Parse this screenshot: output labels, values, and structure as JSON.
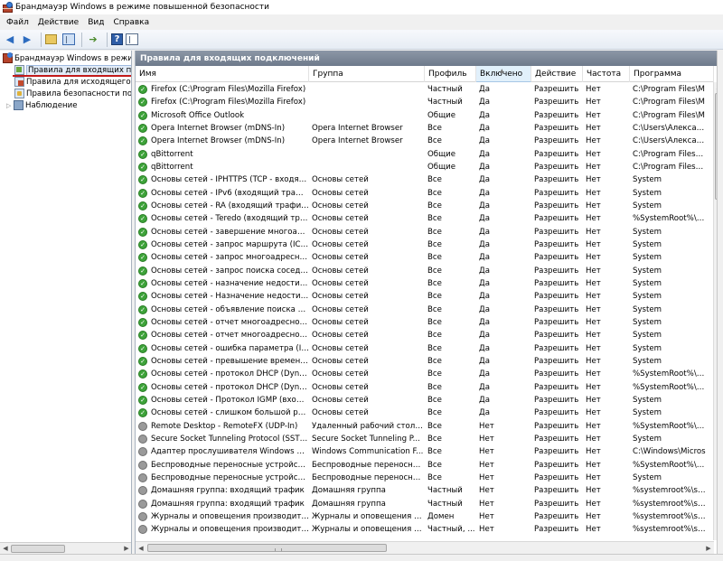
{
  "window": {
    "title": "Брандмауэр Windows в режиме повышенной безопасности"
  },
  "menu": [
    "Файл",
    "Действие",
    "Вид",
    "Справка"
  ],
  "toolbar": {
    "icons": [
      "back-arrow-icon",
      "forward-arrow-icon",
      "folder-up-icon",
      "show-hide-tree-icon",
      "export-list-icon",
      "help-icon",
      "show-hide-action-pane-icon"
    ]
  },
  "tree": {
    "root": "Брандмауэр Windows в режим",
    "items": [
      {
        "label": "Правила для входящих по,",
        "icon": "inbound-rules-icon",
        "selected": true
      },
      {
        "label": "Правила для исходящего г",
        "icon": "outbound-rules-icon"
      },
      {
        "label": "Правила безопасности по,",
        "icon": "connection-security-icon"
      },
      {
        "label": "Наблюдение",
        "icon": "monitoring-icon",
        "expandable": true
      }
    ]
  },
  "panel": {
    "title": "Правила для входящих подключений"
  },
  "columns": [
    "Имя",
    "Группа",
    "Профиль",
    "Включено",
    "Действие",
    "Частота",
    "Программа"
  ],
  "sorted_column": "Включено",
  "rules": [
    {
      "enabled": true,
      "name": "Firefox (C:\\Program Files\\Mozilla Firefox)",
      "group": "",
      "profile": "Частный",
      "on": "Да",
      "action": "Разрешить",
      "override": "Нет",
      "program": "C:\\Program Files\\M"
    },
    {
      "enabled": true,
      "name": "Firefox (C:\\Program Files\\Mozilla Firefox)",
      "group": "",
      "profile": "Частный",
      "on": "Да",
      "action": "Разрешить",
      "override": "Нет",
      "program": "C:\\Program Files\\M"
    },
    {
      "enabled": true,
      "name": "Microsoft Office Outlook",
      "group": "",
      "profile": "Общие",
      "on": "Да",
      "action": "Разрешить",
      "override": "Нет",
      "program": "C:\\Program Files\\M"
    },
    {
      "enabled": true,
      "name": "Opera Internet Browser (mDNS-In)",
      "group": "Opera Internet Browser",
      "profile": "Все",
      "on": "Да",
      "action": "Разрешить",
      "override": "Нет",
      "program": "C:\\Users\\Александ"
    },
    {
      "enabled": true,
      "name": "Opera Internet Browser (mDNS-In)",
      "group": "Opera Internet Browser",
      "profile": "Все",
      "on": "Да",
      "action": "Разрешить",
      "override": "Нет",
      "program": "C:\\Users\\Александ"
    },
    {
      "enabled": true,
      "name": "qBittorrent",
      "group": "",
      "profile": "Общие",
      "on": "Да",
      "action": "Разрешить",
      "override": "Нет",
      "program": "C:\\Program Files\\qB"
    },
    {
      "enabled": true,
      "name": "qBittorrent",
      "group": "",
      "profile": "Общие",
      "on": "Да",
      "action": "Разрешить",
      "override": "Нет",
      "program": "C:\\Program Files\\qB"
    },
    {
      "enabled": true,
      "name": "Основы сетей - IPHTTPS (TCP - входящ...",
      "group": "Основы сетей",
      "profile": "Все",
      "on": "Да",
      "action": "Разрешить",
      "override": "Нет",
      "program": "System"
    },
    {
      "enabled": true,
      "name": "Основы сетей - IPv6 (входящий трафик ...",
      "group": "Основы сетей",
      "profile": "Все",
      "on": "Да",
      "action": "Разрешить",
      "override": "Нет",
      "program": "System"
    },
    {
      "enabled": true,
      "name": "Основы сетей - RA (входящий трафик I...",
      "group": "Основы сетей",
      "profile": "Все",
      "on": "Да",
      "action": "Разрешить",
      "override": "Нет",
      "program": "System"
    },
    {
      "enabled": true,
      "name": "Основы сетей - Teredo (входящий траф...",
      "group": "Основы сетей",
      "profile": "Все",
      "on": "Да",
      "action": "Разрешить",
      "override": "Нет",
      "program": "%SystemRoot%\\sys"
    },
    {
      "enabled": true,
      "name": "Основы сетей - завершение многоадр...",
      "group": "Основы сетей",
      "profile": "Все",
      "on": "Да",
      "action": "Разрешить",
      "override": "Нет",
      "program": "System"
    },
    {
      "enabled": true,
      "name": "Основы сетей - запрос маршрута (ICM...",
      "group": "Основы сетей",
      "profile": "Все",
      "on": "Да",
      "action": "Разрешить",
      "override": "Нет",
      "program": "System"
    },
    {
      "enabled": true,
      "name": "Основы сетей - запрос многоадресног...",
      "group": "Основы сетей",
      "profile": "Все",
      "on": "Да",
      "action": "Разрешить",
      "override": "Нет",
      "program": "System"
    },
    {
      "enabled": true,
      "name": "Основы сетей - запрос поиска соседей...",
      "group": "Основы сетей",
      "profile": "Все",
      "on": "Да",
      "action": "Разрешить",
      "override": "Нет",
      "program": "System"
    },
    {
      "enabled": true,
      "name": "Основы сетей - назначение недостижи...",
      "group": "Основы сетей",
      "profile": "Все",
      "on": "Да",
      "action": "Разрешить",
      "override": "Нет",
      "program": "System"
    },
    {
      "enabled": true,
      "name": "Основы сетей - Назначение недостижи...",
      "group": "Основы сетей",
      "profile": "Все",
      "on": "Да",
      "action": "Разрешить",
      "override": "Нет",
      "program": "System"
    },
    {
      "enabled": true,
      "name": "Основы сетей - объявление поиска со...",
      "group": "Основы сетей",
      "profile": "Все",
      "on": "Да",
      "action": "Разрешить",
      "override": "Нет",
      "program": "System"
    },
    {
      "enabled": true,
      "name": "Основы сетей - отчет многоадресного ...",
      "group": "Основы сетей",
      "profile": "Все",
      "on": "Да",
      "action": "Разрешить",
      "override": "Нет",
      "program": "System"
    },
    {
      "enabled": true,
      "name": "Основы сетей - отчет многоадресного ...",
      "group": "Основы сетей",
      "profile": "Все",
      "on": "Да",
      "action": "Разрешить",
      "override": "Нет",
      "program": "System"
    },
    {
      "enabled": true,
      "name": "Основы сетей - ошибка параметра (IC...",
      "group": "Основы сетей",
      "profile": "Все",
      "on": "Да",
      "action": "Разрешить",
      "override": "Нет",
      "program": "System"
    },
    {
      "enabled": true,
      "name": "Основы сетей - превышение времени ...",
      "group": "Основы сетей",
      "profile": "Все",
      "on": "Да",
      "action": "Разрешить",
      "override": "Нет",
      "program": "System"
    },
    {
      "enabled": true,
      "name": "Основы сетей - протокол DHCP (Dyna...",
      "group": "Основы сетей",
      "profile": "Все",
      "on": "Да",
      "action": "Разрешить",
      "override": "Нет",
      "program": "%SystemRoot%\\sys"
    },
    {
      "enabled": true,
      "name": "Основы сетей - протокол DHCP (Dyna...",
      "group": "Основы сетей",
      "profile": "Все",
      "on": "Да",
      "action": "Разрешить",
      "override": "Нет",
      "program": "%SystemRoot%\\sys"
    },
    {
      "enabled": true,
      "name": "Основы сетей - Протокол IGMP (входя...",
      "group": "Основы сетей",
      "profile": "Все",
      "on": "Да",
      "action": "Разрешить",
      "override": "Нет",
      "program": "System"
    },
    {
      "enabled": true,
      "name": "Основы сетей - слишком большой раз...",
      "group": "Основы сетей",
      "profile": "Все",
      "on": "Да",
      "action": "Разрешить",
      "override": "Нет",
      "program": "System"
    },
    {
      "enabled": false,
      "name": "Remote Desktop - RemoteFX (UDP-In)",
      "group": "Удаленный рабочий стол -...",
      "profile": "Все",
      "on": "Нет",
      "action": "Разрешить",
      "override": "Нет",
      "program": "%SystemRoot%\\sys"
    },
    {
      "enabled": false,
      "name": "Secure Socket Tunneling Protocol (SSTP-...",
      "group": "Secure Socket Tunneling P...",
      "profile": "Все",
      "on": "Нет",
      "action": "Разрешить",
      "override": "Нет",
      "program": "System"
    },
    {
      "enabled": false,
      "name": "Адаптер прослушивателя Windows Co...",
      "group": "Windows Communication F...",
      "profile": "Все",
      "on": "Нет",
      "action": "Разрешить",
      "override": "Нет",
      "program": "C:\\Windows\\Micros"
    },
    {
      "enabled": false,
      "name": "Беспроводные переносные устройства...",
      "group": "Беспроводные переносны...",
      "profile": "Все",
      "on": "Нет",
      "action": "Разрешить",
      "override": "Нет",
      "program": "%SystemRoot%\\sys"
    },
    {
      "enabled": false,
      "name": "Беспроводные переносные устройства...",
      "group": "Беспроводные переносны...",
      "profile": "Все",
      "on": "Нет",
      "action": "Разрешить",
      "override": "Нет",
      "program": "System"
    },
    {
      "enabled": false,
      "name": "Домашняя группа: входящий трафик",
      "group": "Домашняя группа",
      "profile": "Частный",
      "on": "Нет",
      "action": "Разрешить",
      "override": "Нет",
      "program": "%systemroot%\\syst"
    },
    {
      "enabled": false,
      "name": "Домашняя группа: входящий трафик",
      "group": "Домашняя группа",
      "profile": "Частный",
      "on": "Нет",
      "action": "Разрешить",
      "override": "Нет",
      "program": "%systemroot%\\syst"
    },
    {
      "enabled": false,
      "name": "Журналы и оповещения производител...",
      "group": "Журналы и оповещения п...",
      "profile": "Домен",
      "on": "Нет",
      "action": "Разрешить",
      "override": "Нет",
      "program": "%systemroot%\\syst"
    },
    {
      "enabled": false,
      "name": "Журналы и оповещения производител...",
      "group": "Журналы и оповещения п...",
      "profile": "Частный, ...",
      "on": "Нет",
      "action": "Разрешить",
      "override": "Нет",
      "program": "%systemroot%\\syst"
    }
  ]
}
